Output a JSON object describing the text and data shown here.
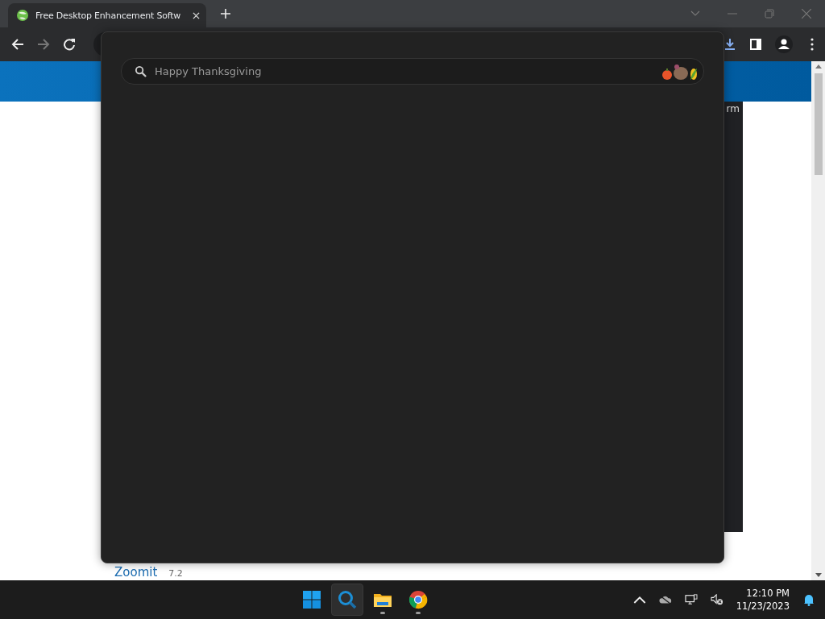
{
  "browser": {
    "tab": {
      "title": "Free Desktop Enhancement Softw"
    },
    "nav": [
      {
        "kind": "back",
        "disabled": false
      },
      {
        "kind": "forward",
        "disabled": true
      },
      {
        "kind": "reload",
        "disabled": false
      }
    ]
  },
  "page": {
    "partial_text": "rm",
    "product": {
      "name": "Zoomit",
      "version": "7.2"
    }
  },
  "search_overlay": {
    "placeholder": "Happy Thanksgiving"
  },
  "taskbar": {
    "apps": [
      {
        "kind": "start",
        "selected": false,
        "running": false
      },
      {
        "kind": "search",
        "selected": true,
        "running": false
      },
      {
        "kind": "files",
        "selected": false,
        "running": true
      },
      {
        "kind": "chrome",
        "selected": false,
        "running": true
      }
    ],
    "clock": {
      "time": "12:10 PM",
      "date": "11/23/2023"
    }
  }
}
